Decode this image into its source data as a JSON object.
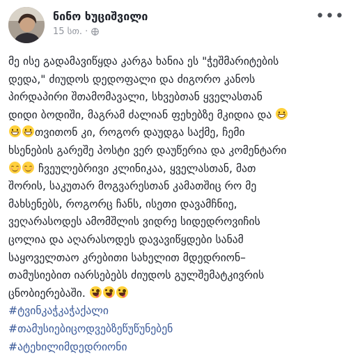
{
  "post": {
    "author": "ნინო ხუციშვილი",
    "time": "15 სთ. ·",
    "privacy_icon": "globe-icon",
    "more_icon": "more-options-icon",
    "more_label": "•••"
  },
  "lines": [
    "მე ისე გადამავიწყდა კარგა ხანია ეს \"ჭეშმარიტების",
    "დედა,\" ძიუდოს დედოფალი და ძიგორო კანოს",
    "პირდაპირი შთამომავალი, სხვებთან ყველასთან",
    "დიდი ბოდიში, მაგრამ ძალიან ფეხებზე მკიდია და",
    "თვითონ კი, როგორ დაუდგა საქმე, ჩემი",
    "ხსენების გარეშე პოსტი ვერ დაუწერია და კომენტარი",
    "ჩვეულებრივი კლინიკაა, ყველასთან, მათ",
    "შორის, საკუთარ მოგვარესთან კამათშიც რო მე",
    "მახსენებს, როგორც ჩანს, ისეთი დავამჩნიე,",
    "ვეღარასოდეს ამომშლის ვიდრე სიდედროვიჩის",
    "ცოლია და აღარასოდეს დავავიწყდები სანამ",
    "საყოველთაო კრებითი სახელით მდედრიონ–",
    "თამუსიებით იარსებებს ძიუდოს გულშემატკივრის",
    "ცნობიერებაში."
  ],
  "hashtags": [
    "#ტვინკაჭკაჭაქალი",
    "#თამუსიებიცოდვებზეწუწუნებენ",
    "#ატეხილიმდედრიონი"
  ],
  "emojis": {
    "grin": "grinning-face-icon",
    "blush": "smiling-face-icon",
    "tongue": "winking-tongue-face-icon"
  }
}
